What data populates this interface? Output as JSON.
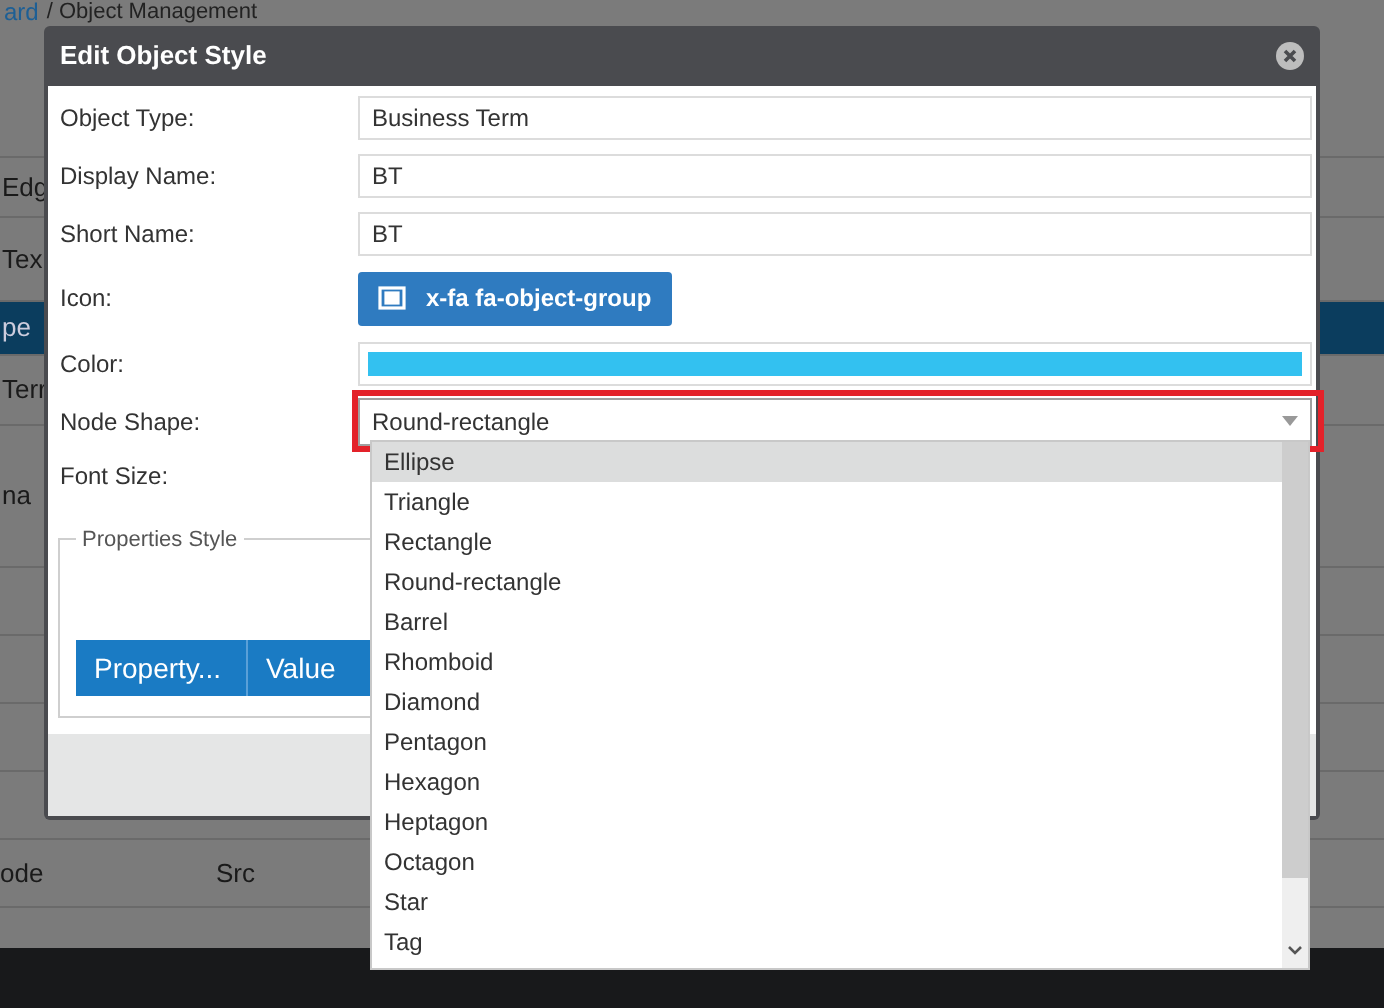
{
  "page": {
    "breadcrumb_link": "ard",
    "breadcrumb": "/ Object Management",
    "rows": [
      {
        "text": "Edg",
        "selected": false
      },
      {
        "text": "Tex",
        "selected": false
      },
      {
        "text": "pe",
        "selected": true
      },
      {
        "text": "Terr",
        "selected": false
      },
      {
        "text": "na",
        "selected": false
      }
    ],
    "last_row": [
      "ode",
      "Src"
    ]
  },
  "dialog": {
    "title": "Edit Object Style",
    "fields": [
      {
        "kind": "text",
        "label": "Object Type:",
        "value": "Business Term"
      },
      {
        "kind": "text",
        "label": "Display Name:",
        "value": "BT"
      },
      {
        "kind": "text",
        "label": "Short Name:",
        "value": "BT"
      },
      {
        "kind": "button",
        "label": "Icon:",
        "value": "x-fa fa-object-group"
      },
      {
        "kind": "color",
        "label": "Color:",
        "color": "#33c1f0"
      },
      {
        "kind": "select",
        "label": "Node Shape:",
        "value": "Round-rectangle",
        "highlighted": true
      },
      {
        "kind": "none",
        "label": "Font Size:"
      }
    ],
    "properties": {
      "legend": "Properties Style",
      "columns": [
        "Property...",
        "Value"
      ]
    },
    "dropdown": {
      "options": [
        {
          "label": "Ellipse",
          "selected": true
        },
        {
          "label": "Triangle",
          "selected": false
        },
        {
          "label": "Rectangle",
          "selected": false
        },
        {
          "label": "Round-rectangle",
          "selected": false
        },
        {
          "label": "Barrel",
          "selected": false
        },
        {
          "label": "Rhomboid",
          "selected": false
        },
        {
          "label": "Diamond",
          "selected": false
        },
        {
          "label": "Pentagon",
          "selected": false
        },
        {
          "label": "Hexagon",
          "selected": false
        },
        {
          "label": "Heptagon",
          "selected": false
        },
        {
          "label": "Octagon",
          "selected": false
        },
        {
          "label": "Star",
          "selected": false
        },
        {
          "label": "Tag",
          "selected": false
        }
      ]
    }
  }
}
